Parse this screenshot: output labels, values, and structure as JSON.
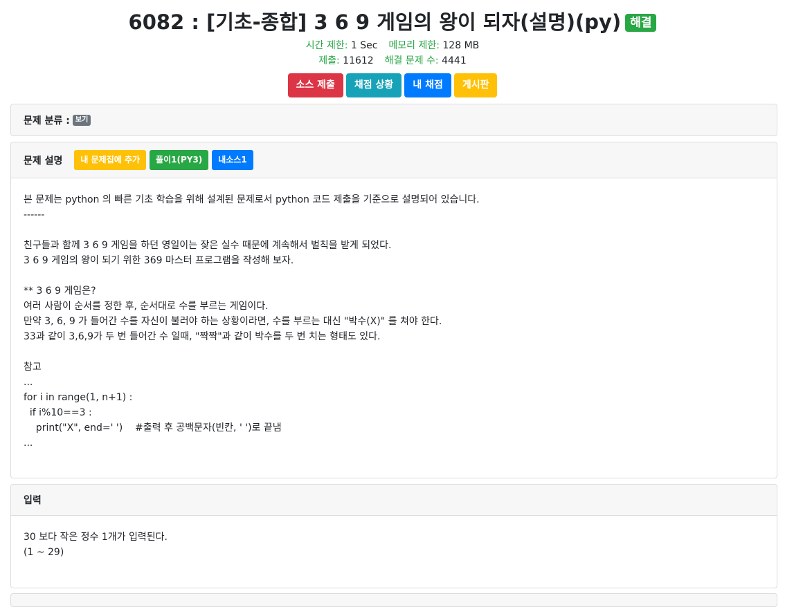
{
  "problem": {
    "title": "6082 : [기초-종합] 3 6 9 게임의 왕이 되자(설명)(py)",
    "solved_badge": "해결",
    "time_limit_label": "시간 제한:",
    "time_limit_value": "1 Sec",
    "memory_limit_label": "메모리 제한:",
    "memory_limit_value": "128 MB",
    "submissions_label": "제출:",
    "submissions_value": "11612",
    "solved_label": "해결 문제 수:",
    "solved_value": "4441"
  },
  "actions": {
    "submit": "소스 제출",
    "status": "채점 상황",
    "my_status": "내 채점",
    "board": "게시판"
  },
  "category": {
    "label": "문제 분류 :",
    "view_badge": "보기"
  },
  "description": {
    "header": "문제 설명",
    "add_button": "내 문제집에 추가",
    "solution_button": "풀이1(PY3)",
    "my_source_button": "내소스1",
    "lines": [
      "본 문제는 python 의 빠른 기초 학습을 위해 설계된 문제로서 python 코드 제출을 기준으로 설명되어 있습니다.",
      "------",
      "",
      "친구들과 함께 3 6 9 게임을 하던 영일이는 잦은 실수 때문에 계속해서 벌칙을 받게 되었다.",
      "3 6 9 게임의 왕이 되기 위한 369 마스터 프로그램을 작성해 보자.",
      "",
      "** 3 6 9 게임은?",
      "여러 사람이 순서를 정한 후, 순서대로 수를 부르는 게임이다.",
      "만약 3, 6, 9 가 들어간 수를 자신이 불러야 하는 상황이라면, 수를 부르는 대신 \"박수(X)\" 를 쳐야 한다.",
      "33과 같이 3,6,9가 두 번 들어간 수 일때, \"짝짝\"과 같이 박수를 두 번 치는 형태도 있다.",
      "",
      "참고",
      "...",
      "for i in range(1, n+1) :",
      "  if i%10==3 :",
      "    print(\"X\", end=' ')    #출력 후 공백문자(빈칸, ' ')로 끝냄",
      "..."
    ]
  },
  "input": {
    "header": "입력",
    "lines": [
      "30 보다 작은 정수 1개가 입력된다.",
      "(1 ~ 29)"
    ]
  }
}
